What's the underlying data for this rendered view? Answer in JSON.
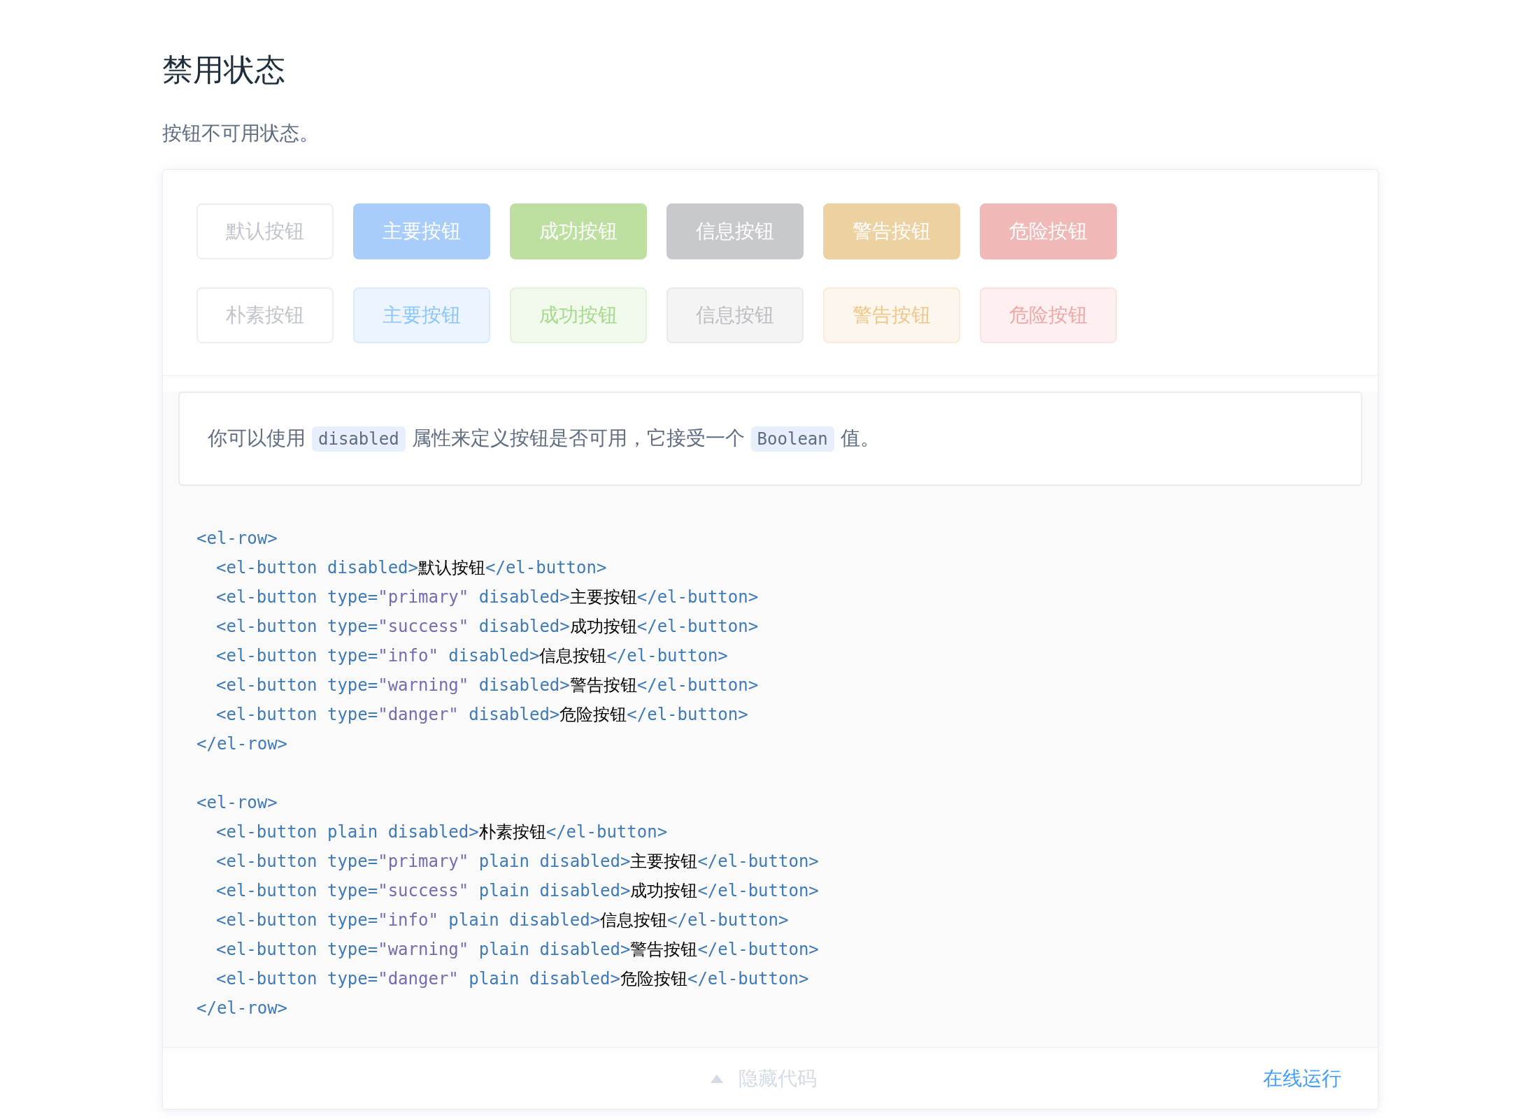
{
  "title": "禁用状态",
  "description": "按钮不可用状态。",
  "demo": {
    "button_rows": [
      {
        "buttons": [
          {
            "label": "默认按钮",
            "kind": "default",
            "plain": false,
            "disabled": true
          },
          {
            "label": "主要按钮",
            "kind": "primary",
            "plain": false,
            "disabled": true
          },
          {
            "label": "成功按钮",
            "kind": "success",
            "plain": false,
            "disabled": true
          },
          {
            "label": "信息按钮",
            "kind": "info",
            "plain": false,
            "disabled": true
          },
          {
            "label": "警告按钮",
            "kind": "warning",
            "plain": false,
            "disabled": true
          },
          {
            "label": "危险按钮",
            "kind": "danger",
            "plain": false,
            "disabled": true
          }
        ]
      },
      {
        "buttons": [
          {
            "label": "朴素按钮",
            "kind": "default",
            "plain": true,
            "disabled": true
          },
          {
            "label": "主要按钮",
            "kind": "primary",
            "plain": true,
            "disabled": true
          },
          {
            "label": "成功按钮",
            "kind": "success",
            "plain": true,
            "disabled": true
          },
          {
            "label": "信息按钮",
            "kind": "info",
            "plain": true,
            "disabled": true
          },
          {
            "label": "警告按钮",
            "kind": "warning",
            "plain": true,
            "disabled": true
          },
          {
            "label": "危险按钮",
            "kind": "danger",
            "plain": true,
            "disabled": true
          }
        ]
      }
    ],
    "explanation": [
      {
        "kind": "text",
        "text": "你可以使用"
      },
      {
        "kind": "code",
        "text": "disabled"
      },
      {
        "kind": "text",
        "text": "属性来定义按钮是否可用，它接受一个"
      },
      {
        "kind": "code",
        "text": "Boolean"
      },
      {
        "kind": "text",
        "text": "值。"
      }
    ],
    "code": {
      "groups": [
        {
          "lines": [
            {
              "tokens": [
                {
                  "kind": "tag",
                  "text": "<el-row>"
                }
              ],
              "children": [
                {
                  "tokens": [
                    {
                      "kind": "tag",
                      "text": "<el-button disabled>"
                    },
                    {
                      "kind": "text",
                      "text": "默认按钮"
                    },
                    {
                      "kind": "tag",
                      "text": "</el-button>"
                    }
                  ]
                },
                {
                  "tokens": [
                    {
                      "kind": "tag",
                      "text": "<el-button type="
                    },
                    {
                      "kind": "string",
                      "text": "\"primary\""
                    },
                    {
                      "kind": "tag",
                      "text": " disabled>"
                    },
                    {
                      "kind": "text",
                      "text": "主要按钮"
                    },
                    {
                      "kind": "tag",
                      "text": "</el-button>"
                    }
                  ]
                },
                {
                  "tokens": [
                    {
                      "kind": "tag",
                      "text": "<el-button type="
                    },
                    {
                      "kind": "string",
                      "text": "\"success\""
                    },
                    {
                      "kind": "tag",
                      "text": " disabled>"
                    },
                    {
                      "kind": "text",
                      "text": "成功按钮"
                    },
                    {
                      "kind": "tag",
                      "text": "</el-button>"
                    }
                  ]
                },
                {
                  "tokens": [
                    {
                      "kind": "tag",
                      "text": "<el-button type="
                    },
                    {
                      "kind": "string",
                      "text": "\"info\""
                    },
                    {
                      "kind": "tag",
                      "text": " disabled>"
                    },
                    {
                      "kind": "text",
                      "text": "信息按钮"
                    },
                    {
                      "kind": "tag",
                      "text": "</el-button>"
                    }
                  ]
                },
                {
                  "tokens": [
                    {
                      "kind": "tag",
                      "text": "<el-button type="
                    },
                    {
                      "kind": "string",
                      "text": "\"warning\""
                    },
                    {
                      "kind": "tag",
                      "text": " disabled>"
                    },
                    {
                      "kind": "text",
                      "text": "警告按钮"
                    },
                    {
                      "kind": "tag",
                      "text": "</el-button>"
                    }
                  ]
                },
                {
                  "tokens": [
                    {
                      "kind": "tag",
                      "text": "<el-button type="
                    },
                    {
                      "kind": "string",
                      "text": "\"danger\""
                    },
                    {
                      "kind": "tag",
                      "text": " disabled>"
                    },
                    {
                      "kind": "text",
                      "text": "危险按钮"
                    },
                    {
                      "kind": "tag",
                      "text": "</el-button>"
                    }
                  ]
                }
              ]
            },
            {
              "tokens": [
                {
                  "kind": "tag",
                  "text": "</el-row>"
                }
              ]
            }
          ]
        },
        {
          "lines": [
            {
              "tokens": [
                {
                  "kind": "tag",
                  "text": "<el-row>"
                }
              ],
              "children": [
                {
                  "tokens": [
                    {
                      "kind": "tag",
                      "text": "<el-button plain disabled>"
                    },
                    {
                      "kind": "text",
                      "text": "朴素按钮"
                    },
                    {
                      "kind": "tag",
                      "text": "</el-button>"
                    }
                  ]
                },
                {
                  "tokens": [
                    {
                      "kind": "tag",
                      "text": "<el-button type="
                    },
                    {
                      "kind": "string",
                      "text": "\"primary\""
                    },
                    {
                      "kind": "tag",
                      "text": " plain disabled>"
                    },
                    {
                      "kind": "text",
                      "text": "主要按钮"
                    },
                    {
                      "kind": "tag",
                      "text": "</el-button>"
                    }
                  ]
                },
                {
                  "tokens": [
                    {
                      "kind": "tag",
                      "text": "<el-button type="
                    },
                    {
                      "kind": "string",
                      "text": "\"success\""
                    },
                    {
                      "kind": "tag",
                      "text": " plain disabled>"
                    },
                    {
                      "kind": "text",
                      "text": "成功按钮"
                    },
                    {
                      "kind": "tag",
                      "text": "</el-button>"
                    }
                  ]
                },
                {
                  "tokens": [
                    {
                      "kind": "tag",
                      "text": "<el-button type="
                    },
                    {
                      "kind": "string",
                      "text": "\"info\""
                    },
                    {
                      "kind": "tag",
                      "text": " plain disabled>"
                    },
                    {
                      "kind": "text",
                      "text": "信息按钮"
                    },
                    {
                      "kind": "tag",
                      "text": "</el-button>"
                    }
                  ]
                },
                {
                  "tokens": [
                    {
                      "kind": "tag",
                      "text": "<el-button type="
                    },
                    {
                      "kind": "string",
                      "text": "\"warning\""
                    },
                    {
                      "kind": "tag",
                      "text": " plain disabled>"
                    },
                    {
                      "kind": "text",
                      "text": "警告按钮"
                    },
                    {
                      "kind": "tag",
                      "text": "</el-button>"
                    }
                  ]
                },
                {
                  "tokens": [
                    {
                      "kind": "tag",
                      "text": "<el-button type="
                    },
                    {
                      "kind": "string",
                      "text": "\"danger\""
                    },
                    {
                      "kind": "tag",
                      "text": " plain disabled>"
                    },
                    {
                      "kind": "text",
                      "text": "危险按钮"
                    },
                    {
                      "kind": "tag",
                      "text": "</el-button>"
                    }
                  ]
                }
              ]
            },
            {
              "tokens": [
                {
                  "kind": "tag",
                  "text": "</el-row>"
                }
              ]
            }
          ]
        }
      ]
    },
    "toggle": {
      "label": "隐藏代码",
      "expanded": true
    },
    "run_link": "在线运行"
  }
}
